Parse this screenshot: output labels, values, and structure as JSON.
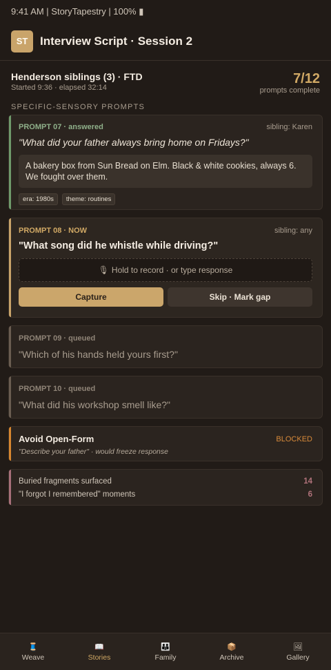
{
  "status_bar": "9:41 AM | StoryTapestry | 100% ▮",
  "header": {
    "logo": "ST",
    "title": "Interview Script · Session 2"
  },
  "session": {
    "name": "Henderson siblings (3) · FTD",
    "meta": "Started 9:36 · elapsed 32:14",
    "progress_count": "7/12",
    "progress_label": "prompts complete"
  },
  "section_label": "SPECIFIC-SENSORY PROMPTS",
  "prompts": [
    {
      "num": "PROMPT 07 · answered",
      "sibling": "sibling: Karen",
      "question": "\"What did your father always bring home on Fridays?\"",
      "answer": "A bakery box from Sun Bread on Elm. Black & white cookies, always 6. We fought over them.",
      "tags": [
        "era: 1980s",
        "theme: routines"
      ],
      "accent": "#6f9a6b"
    },
    {
      "num": "PROMPT 08 · NOW",
      "sibling": "sibling: any",
      "question": "\"What song did he whistle while driving?\"",
      "record_hint": "Hold to record · or type response",
      "capture_label": "Capture",
      "skip_label": "Skip · Mark gap",
      "accent": "#c9a46a"
    },
    {
      "num": "PROMPT 09 · queued",
      "question": "\"Which of his hands held yours first?\"",
      "accent": "#6a5d51"
    },
    {
      "num": "PROMPT 10 · queued",
      "question": "\"What did his workshop smell like?\"",
      "accent": "#6a5d51"
    }
  ],
  "avoid": {
    "title": "Avoid Open-Form",
    "badge": "BLOCKED",
    "sub": "\"Describe your father\" · would freeze response",
    "accent": "#d8872f"
  },
  "stats": {
    "accent": "#a8707a",
    "rows": [
      {
        "label": "Buried fragments surfaced",
        "value": "14"
      },
      {
        "label": "\"I forgot I remembered\" moments",
        "value": "6"
      }
    ]
  },
  "tabs": [
    {
      "icon": "spool-icon",
      "glyph": "🧵",
      "label": "Weave"
    },
    {
      "icon": "book-icon",
      "glyph": "📖",
      "label": "Stories",
      "active": true
    },
    {
      "icon": "family-icon",
      "glyph": "👪",
      "label": "Family"
    },
    {
      "icon": "box-icon",
      "glyph": "📦",
      "label": "Archive"
    },
    {
      "icon": "picture-icon",
      "glyph": "🖼",
      "label": "Gallery"
    }
  ]
}
